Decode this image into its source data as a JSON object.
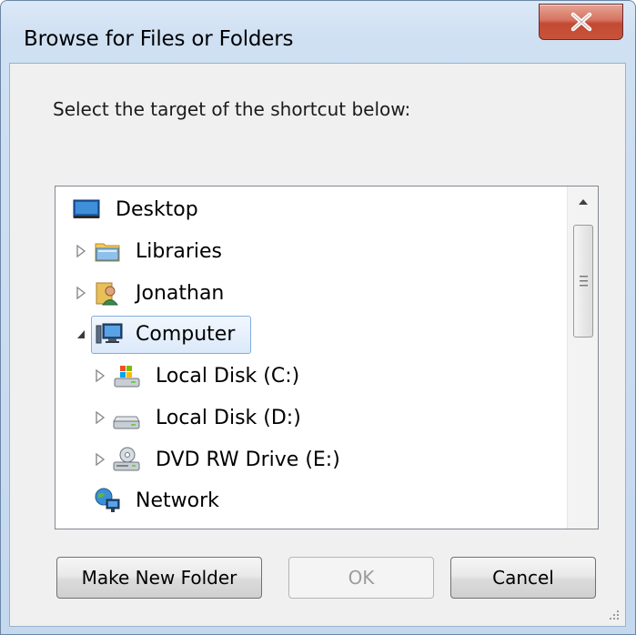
{
  "window": {
    "title": "Browse for Files or Folders",
    "close_icon": "close-icon"
  },
  "prompt": "Select the target of the shortcut below:",
  "tree": {
    "items": [
      {
        "label": "Desktop",
        "icon": "desktop-icon",
        "expander": "none"
      },
      {
        "label": "Libraries",
        "icon": "libraries-icon",
        "expander": "collapsed"
      },
      {
        "label": "Jonathan",
        "icon": "user-folder-icon",
        "expander": "collapsed"
      },
      {
        "label": "Computer",
        "icon": "computer-icon",
        "expander": "expanded",
        "selected": true
      },
      {
        "label": "Local Disk (C:)",
        "icon": "system-drive-icon",
        "expander": "collapsed"
      },
      {
        "label": "Local Disk (D:)",
        "icon": "hard-drive-icon",
        "expander": "collapsed"
      },
      {
        "label": "DVD RW Drive (E:)",
        "icon": "dvd-drive-icon",
        "expander": "collapsed"
      },
      {
        "label": "Network",
        "icon": "network-icon",
        "expander": "none"
      }
    ]
  },
  "buttons": {
    "make_new_folder": "Make New Folder",
    "ok": "OK",
    "cancel": "Cancel"
  },
  "colors": {
    "selection_border": "#84acdd",
    "close_button": "#c24a32",
    "disabled_text": "#9c9c9c"
  }
}
